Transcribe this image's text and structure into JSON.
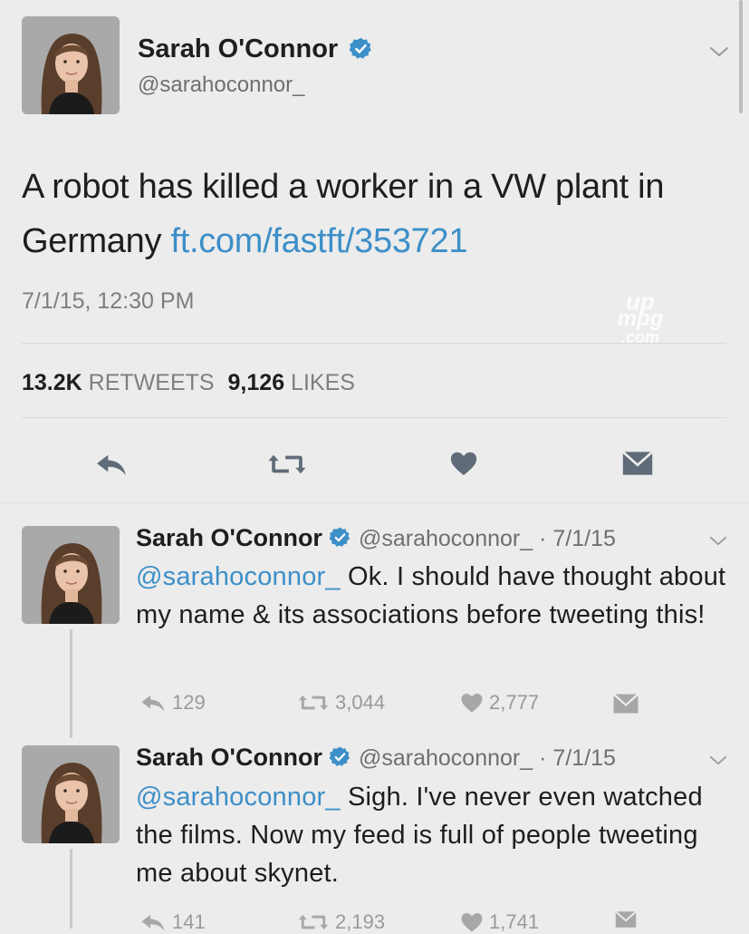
{
  "main_tweet": {
    "name": "Sarah O'Connor",
    "handle": "@sarahoconnor_",
    "text": "A robot has killed a worker in a VW plant in Germany ",
    "link": "ft.com/fastft/353721",
    "timestamp": "7/1/15, 12:30 PM",
    "retweets_count": "13.2K",
    "retweets_label": "RETWEETS",
    "likes_count": "9,126",
    "likes_label": "LIKES"
  },
  "watermark": {
    "line1": "up",
    "line2": "mpg",
    "line3": ".com"
  },
  "replies": [
    {
      "name": "Sarah O'Connor",
      "handle_date": "@sarahoconnor_ · 7/1/15",
      "mention": "@sarahoconnor_",
      "text": " Ok. I should have thought about my name & its associations before tweeting this!",
      "reply_count": "129",
      "retweet_count": "3,044",
      "like_count": "2,777"
    },
    {
      "name": "Sarah O'Connor",
      "handle_date": "@sarahoconnor_ · 7/1/15",
      "mention": "@sarahoconnor_",
      "text": " Sigh. I've never even watched the films. Now my feed is full of people tweeting me about skynet.",
      "reply_count": "141",
      "retweet_count": "2,193",
      "like_count": "1,741"
    }
  ],
  "colors": {
    "link": "#3d8fc8",
    "background": "#ececec",
    "verified": "#3d8fc8",
    "icon": "#5f6b78"
  },
  "icons": [
    "verified-badge-icon",
    "chevron-down-icon",
    "reply-icon",
    "retweet-icon",
    "like-icon",
    "message-icon"
  ]
}
